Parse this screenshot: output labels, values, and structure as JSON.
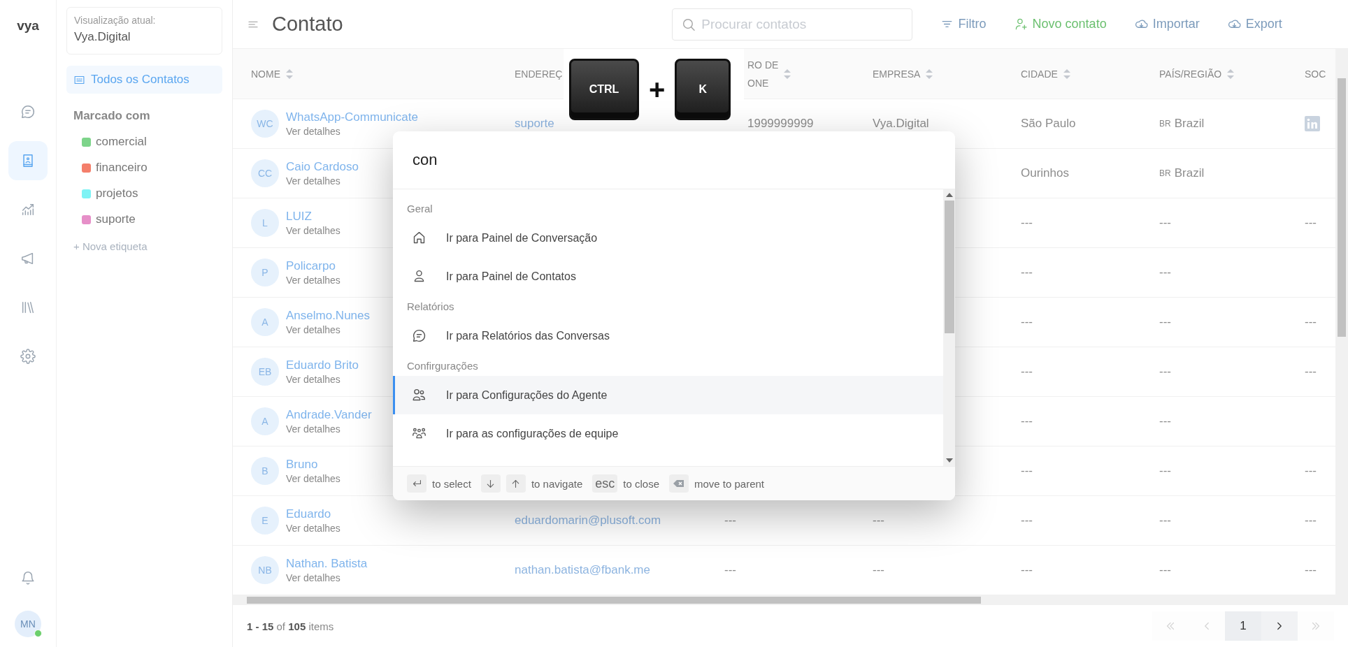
{
  "rail": {
    "logo": "vya",
    "items": [
      {
        "kind": "chat",
        "selected": false
      },
      {
        "kind": "contacts",
        "selected": true
      },
      {
        "kind": "chart",
        "selected": false
      },
      {
        "kind": "megaphone",
        "selected": false
      },
      {
        "kind": "library",
        "selected": false
      },
      {
        "kind": "settings",
        "selected": false
      }
    ],
    "avatar": {
      "initials": "MN",
      "online": true
    }
  },
  "panel": {
    "view_label": "Visualização atual:",
    "view_value": "Vya.Digital",
    "nav": [
      {
        "label": "Todos os Contatos",
        "selected": true
      }
    ],
    "tags_title": "Marcado com",
    "tags": [
      {
        "label": "comercial",
        "color": "#7dd48a"
      },
      {
        "label": "financeiro",
        "color": "#f47f6b"
      },
      {
        "label": "projetos",
        "color": "#7ef3f5"
      },
      {
        "label": "suporte",
        "color": "#e68fc8"
      }
    ],
    "add_tag": "+ Nova etiqueta"
  },
  "header": {
    "title": "Contato",
    "search": {
      "placeholder": "Procurar contatos"
    },
    "actions": [
      {
        "kind": "filter",
        "label": "Filtro"
      },
      {
        "kind": "add",
        "label": "Novo contato"
      },
      {
        "kind": "import",
        "label": "Importar"
      },
      {
        "kind": "export",
        "label": "Export"
      }
    ]
  },
  "table": {
    "columns": [
      {
        "label": "NOME",
        "sortable": true
      },
      {
        "label": "ENDEREÇ",
        "sortable": false
      },
      {
        "label": "RO DE\nONE",
        "sortable": true
      },
      {
        "label": "EMPRESA",
        "sortable": true
      },
      {
        "label": "CIDADE",
        "sortable": true
      },
      {
        "label": "PAÍS/REGIÃO",
        "sortable": true
      },
      {
        "label": "SOC",
        "sortable": false
      }
    ],
    "rows": [
      {
        "initials": "WC",
        "name": "WhatsApp-Communicate",
        "detail": "Ver detalhes",
        "email": "suporte",
        "phone": "1999999999",
        "company": "Vya.Digital",
        "city": "São Paulo",
        "country_code": "BR",
        "country": "Brazil",
        "social_icon": true
      },
      {
        "initials": "CC",
        "name": "Caio Cardoso",
        "detail": "Ver detalhes",
        "city": "Ourinhos",
        "country_code": "BR",
        "country": "Brazil"
      },
      {
        "initials": "L",
        "name": "LUIZ",
        "detail": "Ver detalhes",
        "city": "---",
        "country": "---",
        "social": "---"
      },
      {
        "initials": "P",
        "name": "Policarpo",
        "detail": "Ver detalhes",
        "city": "---",
        "country": "---"
      },
      {
        "initials": "A",
        "name": "Anselmo.Nunes",
        "detail": "Ver detalhes",
        "city": "---",
        "country": "---",
        "social": "---"
      },
      {
        "initials": "EB",
        "name": "Eduardo Brito",
        "detail": "Ver detalhes",
        "city": "---",
        "country": "---",
        "social": "---"
      },
      {
        "initials": "A",
        "name": "Andrade.Vander",
        "detail": "Ver detalhes",
        "city": "---",
        "country": "---"
      },
      {
        "initials": "B",
        "name": "Bruno",
        "detail": "Ver detalhes",
        "city": "---",
        "country": "---",
        "social": "---"
      },
      {
        "initials": "E",
        "name": "Eduardo",
        "detail": "Ver detalhes",
        "email": "eduardomarin@plusoft.com",
        "phone": "---",
        "company": "---",
        "city": "---",
        "country": "---",
        "social": "---"
      },
      {
        "initials": "NB",
        "name": "Nathan. Batista",
        "detail": "Ver detalhes",
        "email": "nathan.batista@fbank.me",
        "phone": "---",
        "company": "---",
        "city": "---",
        "country": "---",
        "social": "---"
      }
    ]
  },
  "footer": {
    "summary": "**1 - 15** of **105** items",
    "pager": [
      {
        "kind": "first",
        "disabled": true
      },
      {
        "kind": "prev",
        "disabled": true
      },
      {
        "kind": "page",
        "label": "1",
        "selected": true
      },
      {
        "kind": "next",
        "disabled": false
      },
      {
        "kind": "last",
        "disabled": true
      }
    ]
  },
  "shortcut": {
    "keys": [
      "CTRL",
      "K"
    ],
    "joiner": "+"
  },
  "palette": {
    "query": "con",
    "sections": [
      {
        "title": "Geral",
        "items": [
          {
            "kind": "home",
            "label": "Ir para Painel de Conversação",
            "selected": false
          },
          {
            "kind": "user",
            "label": "Ir para Painel de Contatos",
            "selected": false
          }
        ]
      },
      {
        "title": "Relatórios",
        "items": [
          {
            "kind": "chat",
            "label": "Ir para Relatórios das Conversas",
            "selected": false
          }
        ]
      },
      {
        "title": "Confirgurações",
        "items": [
          {
            "kind": "users",
            "label": "Ir para Configurações do Agente",
            "selected": true
          },
          {
            "kind": "team",
            "label": "Ir para as configurações de equipe",
            "selected": false
          }
        ]
      }
    ],
    "hints": [
      {
        "keys": [
          {
            "kind": "enter"
          }
        ],
        "text": "to select"
      },
      {
        "keys": [
          {
            "kind": "down"
          },
          {
            "kind": "up"
          }
        ],
        "text": "to navigate"
      },
      {
        "keys": [
          {
            "kind": "text",
            "label": "esc"
          }
        ],
        "text": "to close"
      },
      {
        "keys": [
          {
            "kind": "backspace"
          }
        ],
        "text": "move to parent"
      }
    ]
  }
}
